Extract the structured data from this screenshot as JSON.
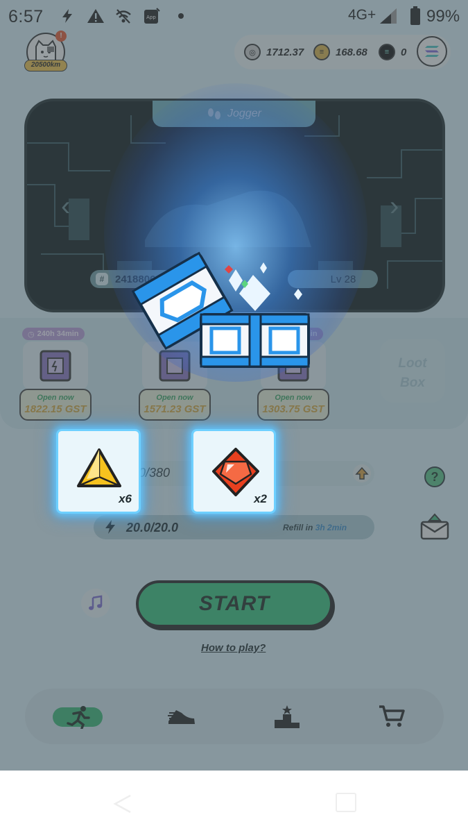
{
  "status_bar": {
    "time": "6:57",
    "network": "4G+",
    "battery": "99%"
  },
  "profile": {
    "distance": "20500km",
    "notification_count": "!"
  },
  "balances": {
    "gmt": "1712.37",
    "gst": "168.68",
    "sol": "0"
  },
  "sneaker": {
    "type": "Jogger",
    "id": "24188062",
    "level": "Lv 28"
  },
  "slots": [
    {
      "timer": "240h 34min",
      "status": "Open now",
      "price": "1822.15 GST"
    },
    {
      "timer": "",
      "status": "Open now",
      "price": "1571.23 GST"
    },
    {
      "timer": "min",
      "status": "Open now",
      "price": "1303.75 GST"
    }
  ],
  "lootbox": {
    "line1": "Loot",
    "line2": "Box"
  },
  "energy": {
    "mint_value": "0/380",
    "value": "20.0/20.0",
    "refill_label": "Refill in",
    "refill_time": "3h 2min"
  },
  "actions": {
    "start": "START",
    "how_to_play": "How to play?"
  },
  "rewards": [
    {
      "item": "yellow-gem",
      "quantity": "x6",
      "color": "#f2b21b"
    },
    {
      "item": "red-gem",
      "quantity": "x2",
      "color": "#e8401f"
    }
  ],
  "colors": {
    "accent_green": "#34c07a",
    "gst_gold": "#d6a63c",
    "refill_blue": "#3a8cc9",
    "glow_blue": "#6ed0ff"
  },
  "bottom_nav": [
    "run-icon",
    "sneaker-icon",
    "leaderboard-icon",
    "cart-icon"
  ]
}
